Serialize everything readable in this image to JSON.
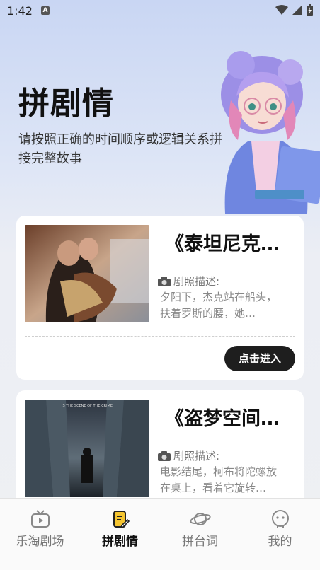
{
  "status": {
    "time": "1:42",
    "notification_icon": "A"
  },
  "header": {
    "title": "拼剧情",
    "subtitle": "请按照正确的时间顺序或逻辑关系拼接完整故事"
  },
  "cards": [
    {
      "title": "《泰坦尼克…",
      "label": "剧照描述:",
      "desc": "夕阳下，杰克站在船头，扶着罗斯的腰，她…",
      "button": "点击进入"
    },
    {
      "title": "《盗梦空间…",
      "label": "剧照描述:",
      "desc": "电影结尾，柯布将陀螺放在桌上，看着它旋转…",
      "poster_text": "IS THE SCENE OF THE CRIME"
    }
  ],
  "nav": [
    {
      "label": "乐淘剧场",
      "icon": "tv-icon"
    },
    {
      "label": "拼剧情",
      "icon": "note-edit-icon",
      "active": true
    },
    {
      "label": "拼台词",
      "icon": "planet-icon"
    },
    {
      "label": "我的",
      "icon": "face-icon"
    }
  ],
  "colors": {
    "button_bg": "#1e1e1e",
    "active_nav": "#111111",
    "inactive_nav": "#777777"
  }
}
